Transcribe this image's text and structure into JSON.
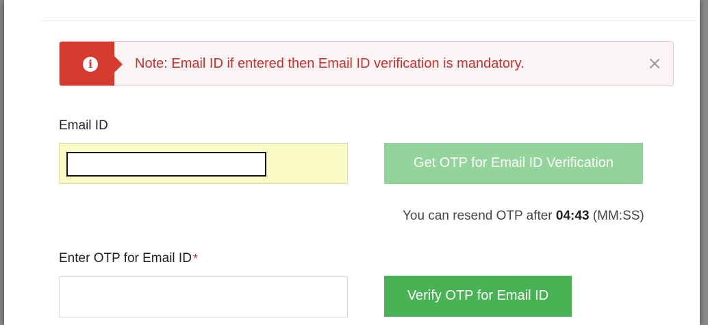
{
  "alert": {
    "icon": "info-icon",
    "text": "Note: Email ID if entered then Email ID verification is mandatory.",
    "close": "×"
  },
  "email": {
    "label": "Email ID",
    "value": "",
    "get_otp_label": "Get OTP for Email ID Verification"
  },
  "resend": {
    "prefix": "You can resend OTP after ",
    "timer": "04:43",
    "suffix": " (MM:SS)"
  },
  "otp": {
    "label": "Enter OTP for Email ID",
    "required_mark": "*",
    "value": "",
    "verify_label": "Verify OTP for Email ID"
  },
  "colors": {
    "alert_red": "#d63b2f",
    "get_otp_green": "#93d49a",
    "verify_green": "#48b255",
    "autofill_yellow": "#fbfbc6"
  }
}
